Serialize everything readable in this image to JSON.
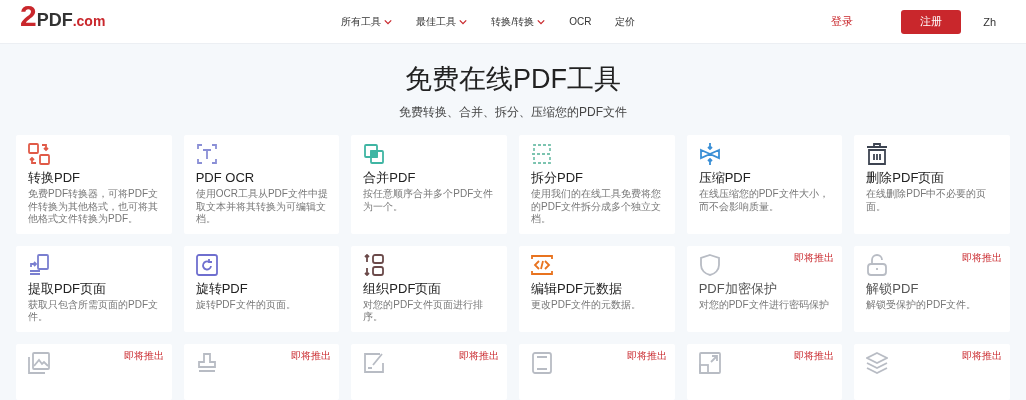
{
  "header": {
    "logo": {
      "digit": "2",
      "name": "PDF",
      ".com": ".com"
    },
    "nav": [
      {
        "label": "所有工具",
        "dropdown": true
      },
      {
        "label": "最佳工具",
        "dropdown": true
      },
      {
        "label": "转换/转换",
        "dropdown": true
      },
      {
        "label": "OCR",
        "dropdown": false
      },
      {
        "label": "定价",
        "dropdown": false
      }
    ],
    "login": "登录",
    "signup": "注册",
    "language": "Zh"
  },
  "hero": {
    "title": "免费在线PDF工具",
    "subtitle": "免费转换、合并、拆分、压缩您的PDF文件"
  },
  "tools": [
    {
      "kind": "convert",
      "title": "转换PDF",
      "desc": "免费PDF转换器，可将PDF文件转换为其他格式，也可将其他格式文件转换为PDF。"
    },
    {
      "kind": "ocr",
      "title": "PDF OCR",
      "desc": "使用OCR工具从PDF文件中提取文本并将其转换为可编辑文档。"
    },
    {
      "kind": "merge",
      "title": "合并PDF",
      "desc": "按任意顺序合并多个PDF文件为一个。"
    },
    {
      "kind": "split",
      "title": "拆分PDF",
      "desc": "使用我们的在线工具免费将您的PDF文件拆分成多个独立文档。"
    },
    {
      "kind": "compress",
      "title": "压缩PDF",
      "desc": "在线压缩您的PDF文件大小，而不会影响质量。"
    },
    {
      "kind": "delete",
      "title": "删除PDF页面",
      "desc": "在线删除PDF中不必要的页面。"
    },
    {
      "kind": "extract",
      "title": "提取PDF页面",
      "desc": "获取只包含所需页面的PDF文件。"
    },
    {
      "kind": "rotate",
      "title": "旋转PDF",
      "desc": "旋转PDF文件的页面。"
    },
    {
      "kind": "organize",
      "title": "组织PDF页面",
      "desc": "对您的PDF文件页面进行排序。"
    },
    {
      "kind": "metadata",
      "title": "编辑PDF元数据",
      "desc": "更改PDF文件的元数据。"
    },
    {
      "kind": "protect",
      "title": "PDF加密保护",
      "desc": "对您的PDF文件进行密码保护",
      "badge": "即将推出"
    },
    {
      "kind": "unlock",
      "title": "解锁PDF",
      "desc": "解锁受保护的PDF文件。",
      "badge": "即将推出"
    },
    {
      "kind": "image",
      "badge": "即将推出"
    },
    {
      "kind": "stamp",
      "badge": "即将推出"
    },
    {
      "kind": "sign",
      "badge": "即将推出"
    },
    {
      "kind": "page",
      "badge": "即将推出"
    },
    {
      "kind": "resize",
      "badge": "即将推出"
    },
    {
      "kind": "layers",
      "badge": "即将推出"
    }
  ]
}
